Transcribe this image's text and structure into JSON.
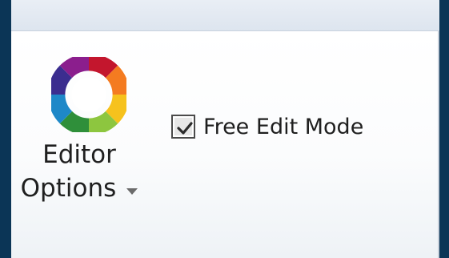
{
  "ribbon": {
    "editor_options": {
      "label_line1": "Editor",
      "label_line2": "Options",
      "icon": "color-wheel-icon",
      "dropdown_icon": "chevron-down-icon"
    },
    "free_edit_mode": {
      "label": "Free Edit Mode",
      "checked": true
    }
  },
  "colors": {
    "frame": "#0b3556",
    "panel": "#ffffff",
    "text": "#1f1f1f",
    "wheel": [
      "#c3162d",
      "#f47b20",
      "#f6c21d",
      "#8dc63f",
      "#2f8f3a",
      "#1e88c8",
      "#3b2d8f",
      "#8b1e8d"
    ]
  }
}
